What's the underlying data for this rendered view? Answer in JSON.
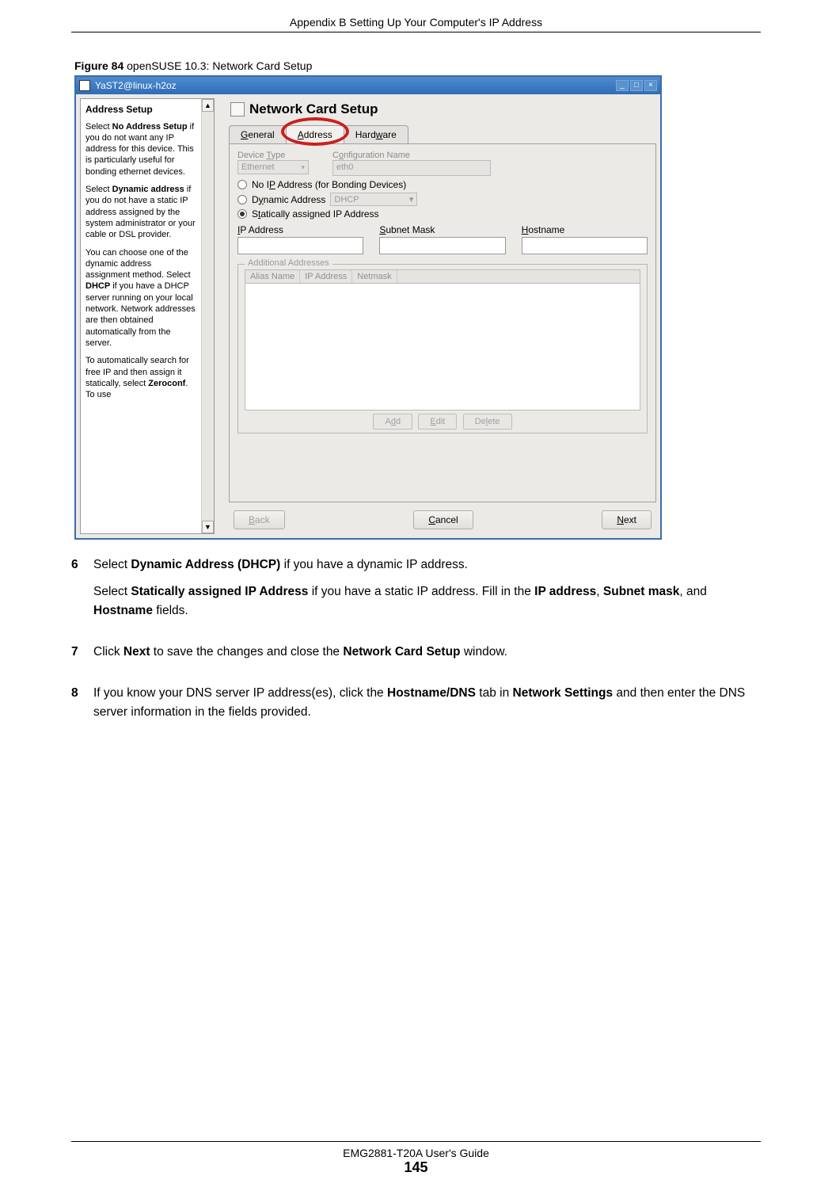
{
  "doc_header": "Appendix B Setting Up Your Computer's IP Address",
  "figure_caption_bold": "Figure 84",
  "figure_caption_rest": "   openSUSE 10.3: Network Card Setup",
  "titlebar": {
    "text": "YaST2@linux-h2oz",
    "min": "_",
    "max": "□",
    "close": "×"
  },
  "help": {
    "heading": "Address Setup",
    "p1a": "Select ",
    "p1b": "No Address Setup",
    "p1c": " if you do not want any IP address for this device. This is particularly useful for bonding ethernet devices.",
    "p2a": "Select ",
    "p2b": "Dynamic address",
    "p2c": " if you do not have a static IP address assigned by the system administrator or your cable or DSL provider.",
    "p3a": "You can choose one of the dynamic address assignment method. Select ",
    "p3b": "DHCP",
    "p3c": " if you have a DHCP server running on your local network. Network addresses are then obtained automatically from the server.",
    "p4a": "To automatically search for free IP and then assign it statically, select ",
    "p4b": "Zeroconf",
    "p4c": ". To use",
    "scroll_up": "▲",
    "scroll_down": "▼"
  },
  "panel": {
    "title": "Network Card Setup",
    "tabs": {
      "general": "General",
      "address": "Address",
      "hardware": "Hardware"
    },
    "device_type_label": "Device Type",
    "device_type_value": "Ethernet",
    "config_name_label": "Configuration Name",
    "config_name_value": "eth0",
    "radio_noip": "No IP Address (for Bonding Devices)",
    "radio_dynamic": "Dynamic Address",
    "dynamic_value": "DHCP",
    "radio_static": "Statically assigned IP Address",
    "ip_label": "IP Address",
    "subnet_label": "Subnet Mask",
    "hostname_label": "Hostname",
    "addl_legend": "Additional Addresses",
    "col_alias": "Alias Name",
    "col_ip": "IP Address",
    "col_netmask": "Netmask",
    "btn_add": "Add",
    "btn_edit": "Edit",
    "btn_delete": "Delete",
    "btn_back": "Back",
    "btn_cancel": "Cancel",
    "btn_next": "Next"
  },
  "steps": {
    "s6num": "6",
    "s6a": "Select ",
    "s6b": "Dynamic Address (DHCP)",
    "s6c": " if you have a dynamic IP address.",
    "s6d": "Select ",
    "s6e": "Statically assigned IP Address",
    "s6f": " if you have a static IP address. Fill in the ",
    "s6g": "IP address",
    "s6h": ", ",
    "s6i": "Subnet mask",
    "s6j": ", and ",
    "s6k": "Hostname",
    "s6l": " fields.",
    "s7num": "7",
    "s7a": "Click ",
    "s7b": "Next",
    "s7c": " to save the changes and close the ",
    "s7d": "Network Card Setup",
    "s7e": " window.",
    "s8num": "8",
    "s8a": "If you know your DNS server IP address(es), click the ",
    "s8b": "Hostname/DNS",
    "s8c": " tab in ",
    "s8d": "Network Settings",
    "s8e": " and then enter the DNS server information in the fields provided."
  },
  "footer": {
    "guide": "EMG2881-T20A User's Guide",
    "page": "145"
  }
}
